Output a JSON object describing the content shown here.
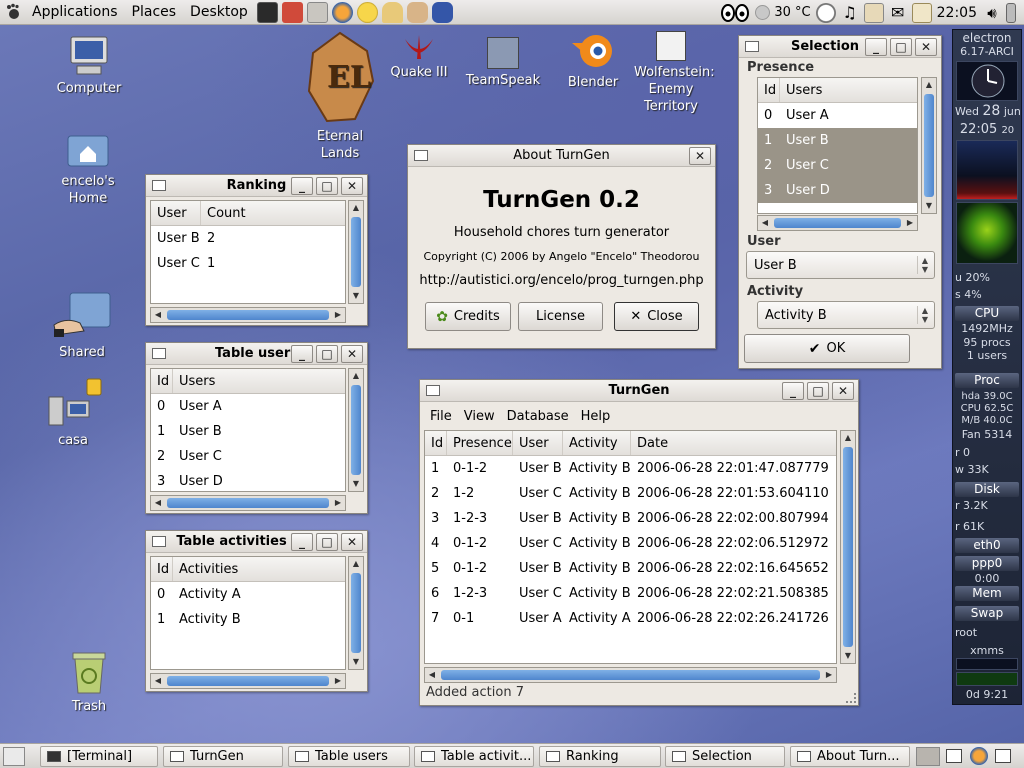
{
  "top_panel": {
    "menus": [
      "Applications",
      "Places",
      "Desktop"
    ],
    "temperature": "30 °C",
    "clock": "22:05"
  },
  "desktop_icons": {
    "computer": "Computer",
    "home": "encelo's Home",
    "shared": "Shared",
    "casa": "casa",
    "trash": "Trash",
    "eternal_lands": "Eternal Lands",
    "quake": "Quake III",
    "teamspeak": "TeamSpeak",
    "blender": "Blender",
    "wolfenstein": "Wolfenstein: Enemy Territory"
  },
  "ranking": {
    "title": "Ranking",
    "columns": [
      "User",
      "Count"
    ],
    "rows": [
      [
        "User B",
        "2"
      ],
      [
        "User C",
        "1"
      ]
    ]
  },
  "table_users": {
    "title": "Table users",
    "columns": [
      "Id",
      "Users"
    ],
    "rows": [
      [
        "0",
        "User A"
      ],
      [
        "1",
        "User B"
      ],
      [
        "2",
        "User C"
      ],
      [
        "3",
        "User D"
      ]
    ]
  },
  "table_activities": {
    "title": "Table activities",
    "columns": [
      "Id",
      "Activities"
    ],
    "rows": [
      [
        "0",
        "Activity A"
      ],
      [
        "1",
        "Activity B"
      ]
    ]
  },
  "about": {
    "title": "About TurnGen",
    "app_name": "TurnGen 0.2",
    "description": "Household chores turn generator",
    "copyright": "Copyright (C) 2006 by Angelo \"Encelo\" Theodorou",
    "url": "http://autistici.org/encelo/prog_turngen.php",
    "credits_label": "Credits",
    "license_label": "License",
    "close_label": "Close"
  },
  "selection": {
    "title": "Selection",
    "presence_label": "Presence",
    "columns": [
      "Id",
      "Users"
    ],
    "rows": [
      [
        "0",
        "User A"
      ],
      [
        "1",
        "User B"
      ],
      [
        "2",
        "User C"
      ],
      [
        "3",
        "User D"
      ]
    ],
    "selected_rows": [
      1,
      2,
      3
    ],
    "user_label": "User",
    "user_value": "User B",
    "activity_label": "Activity",
    "activity_value": "Activity B",
    "ok_label": "OK"
  },
  "turngen": {
    "title": "TurnGen",
    "menus": [
      "File",
      "View",
      "Database",
      "Help"
    ],
    "columns": [
      "Id",
      "Presence",
      "User",
      "Activity",
      "Date"
    ],
    "rows": [
      [
        "1",
        "0-1-2",
        "User B",
        "Activity B",
        "2006-06-28 22:01:47.087779"
      ],
      [
        "2",
        "1-2",
        "User C",
        "Activity B",
        "2006-06-28 22:01:53.604110"
      ],
      [
        "3",
        "1-2-3",
        "User B",
        "Activity B",
        "2006-06-28 22:02:00.807994"
      ],
      [
        "4",
        "0-1-2",
        "User C",
        "Activity B",
        "2006-06-28 22:02:06.512972"
      ],
      [
        "5",
        "0-1-2",
        "User B",
        "Activity B",
        "2006-06-28 22:02:16.645652"
      ],
      [
        "6",
        "1-2-3",
        "User C",
        "Activity B",
        "2006-06-28 22:02:21.508385"
      ],
      [
        "7",
        "0-1",
        "User A",
        "Activity A",
        "2006-06-28 22:02:26.241726"
      ]
    ],
    "status": "Added action 7"
  },
  "gkrellm": {
    "host": "electron",
    "kernel": "6.17-ARCI",
    "day": "Wed",
    "date_num": "28",
    "month": "jun",
    "time": "22:05",
    "time_sec": "20",
    "cpu_user": "u 20%",
    "cpu_sys": "s 4%",
    "cpu_label": "CPU",
    "cpu_freq": "1492MHz",
    "procs": "95 procs",
    "users": "1 users",
    "proc_label": "Proc",
    "hda_temp": "hda 39.0C",
    "cpu_temp": "CPU 62.5C",
    "mb_temp": "M/B 40.0C",
    "fan": "Fan 5314",
    "disk_r0": "r 0",
    "disk_w": "w 33K",
    "disk_label": "Disk",
    "net_1": "r 3.2K",
    "net_2": "r 61K",
    "eth0": "eth0",
    "ppp0": "ppp0",
    "ppp_time": "0:00",
    "mem_label": "Mem",
    "swap_label": "Swap",
    "root_label": "root",
    "xmms_label": "xmms",
    "uptime": "0d 9:21"
  },
  "taskbar": {
    "tasks": [
      "[Terminal]",
      "TurnGen",
      "Table users",
      "Table activit...",
      "Ranking",
      "Selection",
      "About Turn..."
    ]
  }
}
